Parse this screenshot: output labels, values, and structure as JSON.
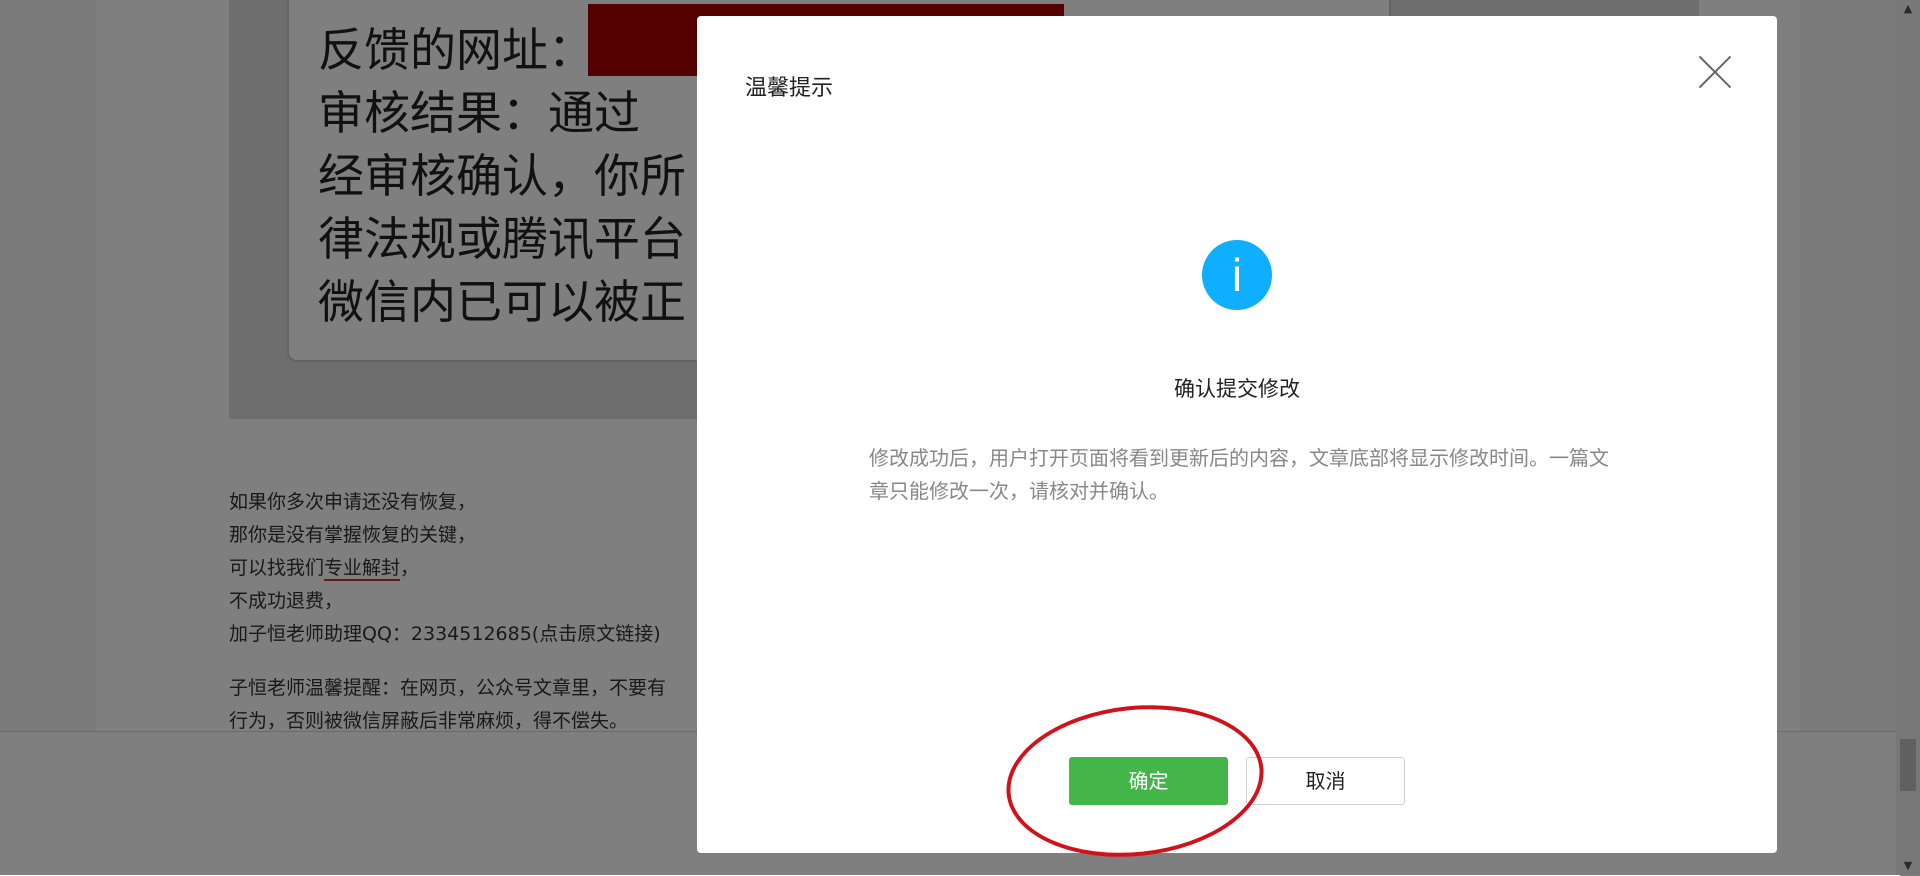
{
  "background_article": {
    "card_lines": [
      "反馈的网址：",
      "审核结果：通过",
      "经审核确认，你所",
      "律法规或腾讯平台",
      "微信内已可以被正"
    ],
    "paragraph_lines": [
      "如果你多次申请还没有恢复，",
      "那你是没有掌握恢复的关键，",
      "可以找我们",
      "不成功退费，",
      "加子恒老师助理QQ：2334512685(点击原文链接)"
    ],
    "link_text": "专业解封",
    "link_suffix": "，",
    "tip_lines": [
      "子恒老师温馨提醒：在网页，公众号文章里，不要有",
      "行为，否则被微信屏蔽后非常麻烦，得不偿失。"
    ]
  },
  "dialog": {
    "title": "温馨提示",
    "close_icon": "close-icon",
    "status_icon": "info-icon",
    "status_icon_glyph": "i",
    "heading": "确认提交修改",
    "description": "修改成功后，用户打开页面将看到更新后的内容，文章底部将显示修改时间。一篇文章只能修改一次，请核对并确认。",
    "confirm_label": "确定",
    "cancel_label": "取消"
  },
  "colors": {
    "primary_button": "#44b549",
    "info_icon": "#10aeff",
    "annotation_ring": "#d0121b",
    "redaction_block": "#a80000"
  }
}
